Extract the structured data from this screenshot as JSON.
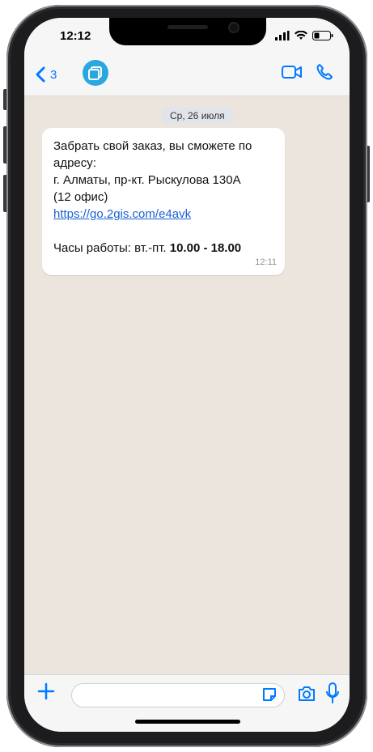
{
  "status_bar": {
    "time": "12:12"
  },
  "header": {
    "back_count": "3"
  },
  "chat": {
    "date": "Ср, 26 июля",
    "message": {
      "line1": "Забрать свой заказ, вы сможете по",
      "line2": "адресу:",
      "line3": "г. Алматы, пр-кт. Рыскулова 130А",
      "line4": "(12 офис)",
      "link": "https://go.2gis.com/e4avk",
      "hours_label": "Часы работы: вт.-пт.",
      "hours_value": "10.00 - 18.00",
      "time": "12:11"
    }
  },
  "colors": {
    "accent": "#007aff",
    "avatar": "#2aa7e0",
    "chat_bg": "#ece5dd",
    "bubble_bg": "#ffffff",
    "link": "#1b61d3"
  },
  "icons": [
    "back-chevron-icon",
    "avatar-icon",
    "video-call-icon",
    "phone-call-icon",
    "plus-icon",
    "sticker-icon",
    "camera-icon",
    "microphone-icon",
    "signal-icon",
    "wifi-icon",
    "battery-icon"
  ]
}
